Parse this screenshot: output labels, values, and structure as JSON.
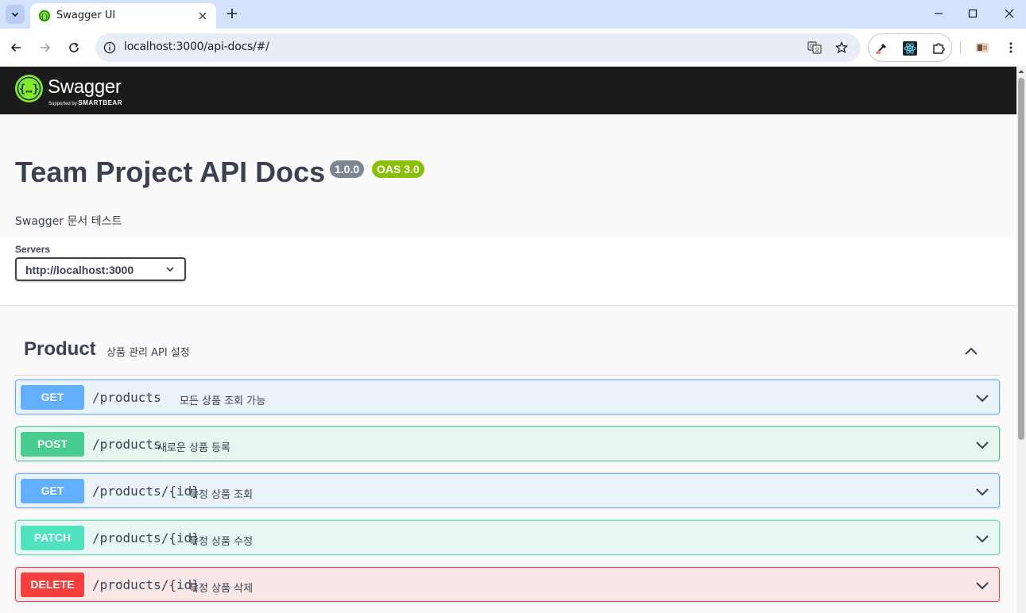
{
  "browser": {
    "tab_title": "Swagger UI",
    "url": "localhost:3000/api-docs/#/"
  },
  "swagger_header": {
    "logo_word": "Swagger",
    "logo_sub_prefix": "Supported by",
    "logo_sub_brand": "SMARTBEAR"
  },
  "info": {
    "title": "Team Project API Docs",
    "version": "1.0.0",
    "oas": "OAS 3.0",
    "description": "Swagger 문서 테스트"
  },
  "servers": {
    "label": "Servers",
    "selected": "http://localhost:3000"
  },
  "tag": {
    "name": "Product",
    "description": "상품 관리 API 설정"
  },
  "operations": [
    {
      "method": "GET",
      "path": "/products",
      "summary": "모든 상품 조회 가능"
    },
    {
      "method": "POST",
      "path": "/products",
      "summary": "새로운 상품 등록"
    },
    {
      "method": "GET",
      "path": "/products/{id}",
      "summary": "특정 상품 조회"
    },
    {
      "method": "PATCH",
      "path": "/products/{id}",
      "summary": "특정 상품 수정"
    },
    {
      "method": "DELETE",
      "path": "/products/{id}",
      "summary": "특정 상품 삭제"
    }
  ],
  "colors": {
    "get": "#61affe",
    "post": "#49cc90",
    "patch": "#50e3c2",
    "delete": "#f93e3e",
    "swagger_green": "#85ea2d",
    "oas_badge": "#89bf04"
  }
}
